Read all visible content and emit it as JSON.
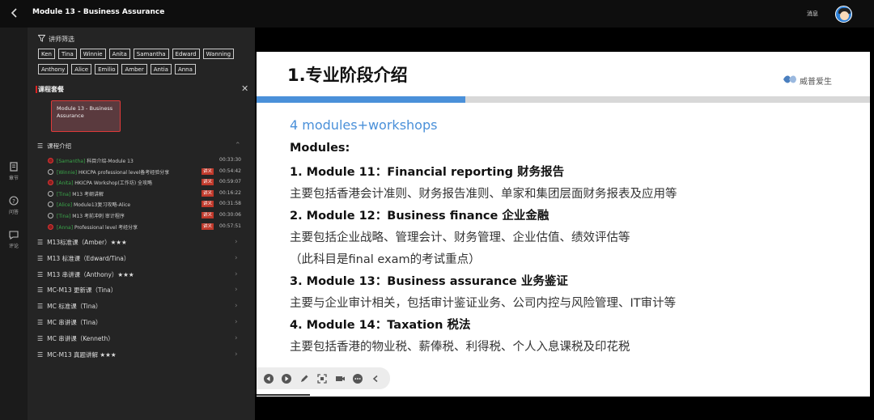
{
  "topbar": {
    "title": "Module 13 - Business Assurance",
    "msg_label": "消息"
  },
  "rail": {
    "items": [
      {
        "label": "章节",
        "icon": "chapter-icon"
      },
      {
        "label": "问答",
        "icon": "question-icon"
      },
      {
        "label": "评论",
        "icon": "comment-icon"
      }
    ]
  },
  "panel": {
    "filter_title": "讲师筛选",
    "tags": [
      "Ken",
      "Tina",
      "Winnie",
      "Anita",
      "Samantha",
      "Edward",
      "Wanning",
      "Anthony",
      "Alice",
      "Emilio",
      "Amber",
      "Antia",
      "Anna"
    ],
    "package_title": "课程套餐",
    "package_card": "Module 13 - Business Assurance",
    "intro_section": "课程介绍",
    "lessons": [
      {
        "teacher": "[Samantha]",
        "title": "科目介绍-Module 13",
        "badge": "",
        "duration": "00:33:30",
        "state": "red"
      },
      {
        "teacher": "[Winnie]",
        "title": "HKICPA professional level备考经验分享",
        "badge": "讲义",
        "duration": "00:54:42",
        "state": "open"
      },
      {
        "teacher": "[Anita]",
        "title": "HKICPA Workshop(工作坊) 全攻略",
        "badge": "讲义",
        "duration": "00:59:07",
        "state": "red"
      },
      {
        "teacher": "[Tina]",
        "title": "M13 考纲讲解",
        "badge": "讲义",
        "duration": "00:16:22",
        "state": "open"
      },
      {
        "teacher": "[Alice]",
        "title": "Module13复习攻略-Alice",
        "badge": "讲义",
        "duration": "00:31:58",
        "state": "open"
      },
      {
        "teacher": "[Tina]",
        "title": "M13 考前冲刺 审计程序",
        "badge": "讲义",
        "duration": "00:30:06",
        "state": "open"
      },
      {
        "teacher": "[Anna]",
        "title": "Professional level 考经分享",
        "badge": "讲义",
        "duration": "00:57:51",
        "state": "red"
      }
    ],
    "sections": [
      "M13标准课（Amber）★★★",
      "M13 标准课（Edward/Tina）",
      "M13 串讲课（Anthony）★★★",
      "MC-M13 更新课（Tina）",
      "MC 标准课（Tina）",
      "MC 串讲课（Tina）",
      "MC 串讲课（Kenneth）",
      "MC-M13 真题讲解 ★★★"
    ]
  },
  "slide": {
    "title": "1.专业阶段介绍",
    "logo_text": "威普爱生",
    "progress": 0.34,
    "subtitle": "4 modules+workshops",
    "modules_label": "Modules:",
    "lines": [
      {
        "kind": "bold",
        "text": "1. Module 11：Financial reporting 财务报告"
      },
      {
        "kind": "norm",
        "text": "主要包括香港会计准则、财务报告准则、单家和集团层面财务报表及应用等"
      },
      {
        "kind": "bold",
        "text": "2. Module 12：Business finance 企业金融"
      },
      {
        "kind": "norm",
        "text": "主要包括企业战略、管理会计、财务管理、企业估值、绩效评估等"
      },
      {
        "kind": "norm",
        "text": "（此科目是final exam的考试重点）"
      },
      {
        "kind": "bold",
        "text": "3. Module 13：Business assurance 业务鉴证"
      },
      {
        "kind": "norm",
        "text": "主要与企业审计相关，包括审计鉴证业务、公司内控与风险管理、IT审计等"
      },
      {
        "kind": "bold",
        "text": "4. Module 14：Taxation 税法"
      },
      {
        "kind": "norm",
        "text": "主要包括香港的物业税、薪俸税、利得税、个人入息课税及印花税"
      }
    ]
  },
  "colors": {
    "accent_red": "#d22222",
    "slide_blue": "#4a90d9",
    "teacher_green": "#3aa64a"
  }
}
